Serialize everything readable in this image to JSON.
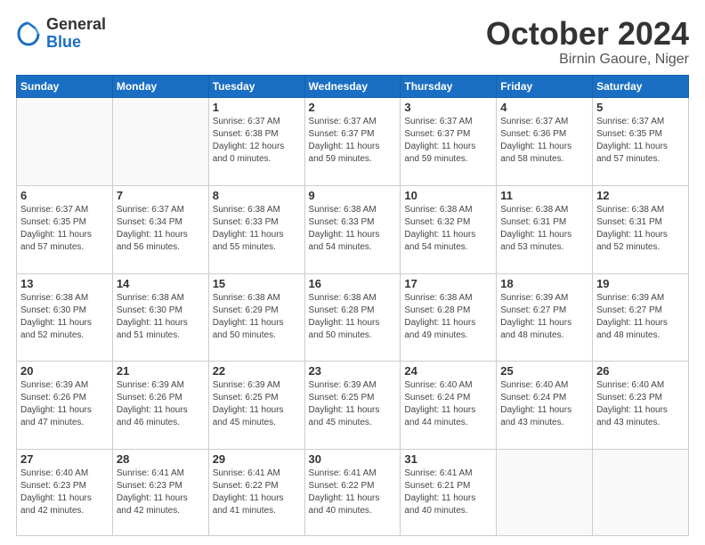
{
  "logo": {
    "general": "General",
    "blue": "Blue"
  },
  "header": {
    "title": "October 2024",
    "subtitle": "Birnin Gaoure, Niger"
  },
  "weekdays": [
    "Sunday",
    "Monday",
    "Tuesday",
    "Wednesday",
    "Thursday",
    "Friday",
    "Saturday"
  ],
  "weeks": [
    [
      {
        "day": "",
        "info": ""
      },
      {
        "day": "",
        "info": ""
      },
      {
        "day": "1",
        "info": "Sunrise: 6:37 AM\nSunset: 6:38 PM\nDaylight: 12 hours\nand 0 minutes."
      },
      {
        "day": "2",
        "info": "Sunrise: 6:37 AM\nSunset: 6:37 PM\nDaylight: 11 hours\nand 59 minutes."
      },
      {
        "day": "3",
        "info": "Sunrise: 6:37 AM\nSunset: 6:37 PM\nDaylight: 11 hours\nand 59 minutes."
      },
      {
        "day": "4",
        "info": "Sunrise: 6:37 AM\nSunset: 6:36 PM\nDaylight: 11 hours\nand 58 minutes."
      },
      {
        "day": "5",
        "info": "Sunrise: 6:37 AM\nSunset: 6:35 PM\nDaylight: 11 hours\nand 57 minutes."
      }
    ],
    [
      {
        "day": "6",
        "info": "Sunrise: 6:37 AM\nSunset: 6:35 PM\nDaylight: 11 hours\nand 57 minutes."
      },
      {
        "day": "7",
        "info": "Sunrise: 6:37 AM\nSunset: 6:34 PM\nDaylight: 11 hours\nand 56 minutes."
      },
      {
        "day": "8",
        "info": "Sunrise: 6:38 AM\nSunset: 6:33 PM\nDaylight: 11 hours\nand 55 minutes."
      },
      {
        "day": "9",
        "info": "Sunrise: 6:38 AM\nSunset: 6:33 PM\nDaylight: 11 hours\nand 54 minutes."
      },
      {
        "day": "10",
        "info": "Sunrise: 6:38 AM\nSunset: 6:32 PM\nDaylight: 11 hours\nand 54 minutes."
      },
      {
        "day": "11",
        "info": "Sunrise: 6:38 AM\nSunset: 6:31 PM\nDaylight: 11 hours\nand 53 minutes."
      },
      {
        "day": "12",
        "info": "Sunrise: 6:38 AM\nSunset: 6:31 PM\nDaylight: 11 hours\nand 52 minutes."
      }
    ],
    [
      {
        "day": "13",
        "info": "Sunrise: 6:38 AM\nSunset: 6:30 PM\nDaylight: 11 hours\nand 52 minutes."
      },
      {
        "day": "14",
        "info": "Sunrise: 6:38 AM\nSunset: 6:30 PM\nDaylight: 11 hours\nand 51 minutes."
      },
      {
        "day": "15",
        "info": "Sunrise: 6:38 AM\nSunset: 6:29 PM\nDaylight: 11 hours\nand 50 minutes."
      },
      {
        "day": "16",
        "info": "Sunrise: 6:38 AM\nSunset: 6:28 PM\nDaylight: 11 hours\nand 50 minutes."
      },
      {
        "day": "17",
        "info": "Sunrise: 6:38 AM\nSunset: 6:28 PM\nDaylight: 11 hours\nand 49 minutes."
      },
      {
        "day": "18",
        "info": "Sunrise: 6:39 AM\nSunset: 6:27 PM\nDaylight: 11 hours\nand 48 minutes."
      },
      {
        "day": "19",
        "info": "Sunrise: 6:39 AM\nSunset: 6:27 PM\nDaylight: 11 hours\nand 48 minutes."
      }
    ],
    [
      {
        "day": "20",
        "info": "Sunrise: 6:39 AM\nSunset: 6:26 PM\nDaylight: 11 hours\nand 47 minutes."
      },
      {
        "day": "21",
        "info": "Sunrise: 6:39 AM\nSunset: 6:26 PM\nDaylight: 11 hours\nand 46 minutes."
      },
      {
        "day": "22",
        "info": "Sunrise: 6:39 AM\nSunset: 6:25 PM\nDaylight: 11 hours\nand 45 minutes."
      },
      {
        "day": "23",
        "info": "Sunrise: 6:39 AM\nSunset: 6:25 PM\nDaylight: 11 hours\nand 45 minutes."
      },
      {
        "day": "24",
        "info": "Sunrise: 6:40 AM\nSunset: 6:24 PM\nDaylight: 11 hours\nand 44 minutes."
      },
      {
        "day": "25",
        "info": "Sunrise: 6:40 AM\nSunset: 6:24 PM\nDaylight: 11 hours\nand 43 minutes."
      },
      {
        "day": "26",
        "info": "Sunrise: 6:40 AM\nSunset: 6:23 PM\nDaylight: 11 hours\nand 43 minutes."
      }
    ],
    [
      {
        "day": "27",
        "info": "Sunrise: 6:40 AM\nSunset: 6:23 PM\nDaylight: 11 hours\nand 42 minutes."
      },
      {
        "day": "28",
        "info": "Sunrise: 6:41 AM\nSunset: 6:23 PM\nDaylight: 11 hours\nand 42 minutes."
      },
      {
        "day": "29",
        "info": "Sunrise: 6:41 AM\nSunset: 6:22 PM\nDaylight: 11 hours\nand 41 minutes."
      },
      {
        "day": "30",
        "info": "Sunrise: 6:41 AM\nSunset: 6:22 PM\nDaylight: 11 hours\nand 40 minutes."
      },
      {
        "day": "31",
        "info": "Sunrise: 6:41 AM\nSunset: 6:21 PM\nDaylight: 11 hours\nand 40 minutes."
      },
      {
        "day": "",
        "info": ""
      },
      {
        "day": "",
        "info": ""
      }
    ]
  ]
}
